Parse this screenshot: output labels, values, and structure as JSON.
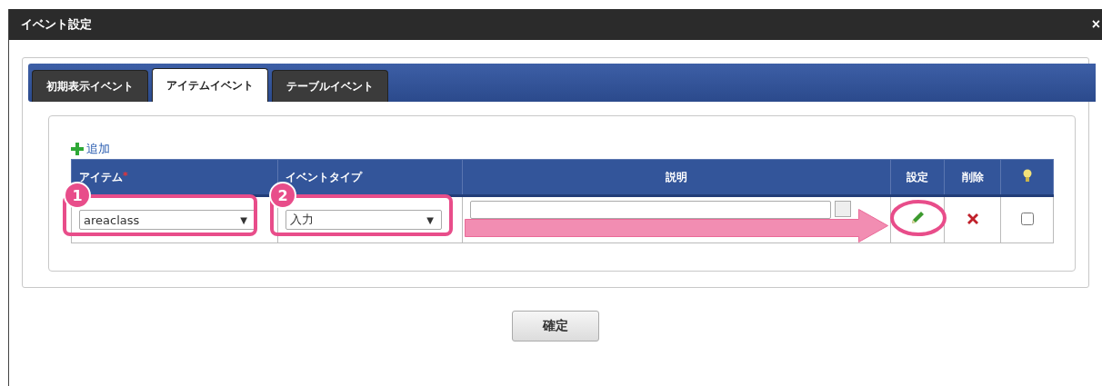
{
  "window": {
    "title": "イベント設定",
    "close": "×"
  },
  "tabs": [
    {
      "label": "初期表示イベント",
      "selected": false
    },
    {
      "label": "アイテムイベント",
      "selected": true
    },
    {
      "label": "テーブルイベント",
      "selected": false
    }
  ],
  "add_link": "追加",
  "table": {
    "columns": [
      {
        "label": "アイテム",
        "required": true
      },
      {
        "label": "イベントタイプ",
        "required": false
      },
      {
        "label": "説明",
        "required": false
      },
      {
        "label": "設定",
        "required": false
      },
      {
        "label": "削除",
        "required": false
      },
      {
        "kind": "bulb"
      }
    ],
    "required_mark": "*",
    "rows": [
      {
        "item": {
          "value": "areaclass",
          "caret": "▼"
        },
        "event_type": {
          "value": "入力",
          "caret": "▼"
        },
        "checked": false
      }
    ]
  },
  "annotations": {
    "badges": [
      "1",
      "2"
    ]
  },
  "confirm_button": "確定"
}
